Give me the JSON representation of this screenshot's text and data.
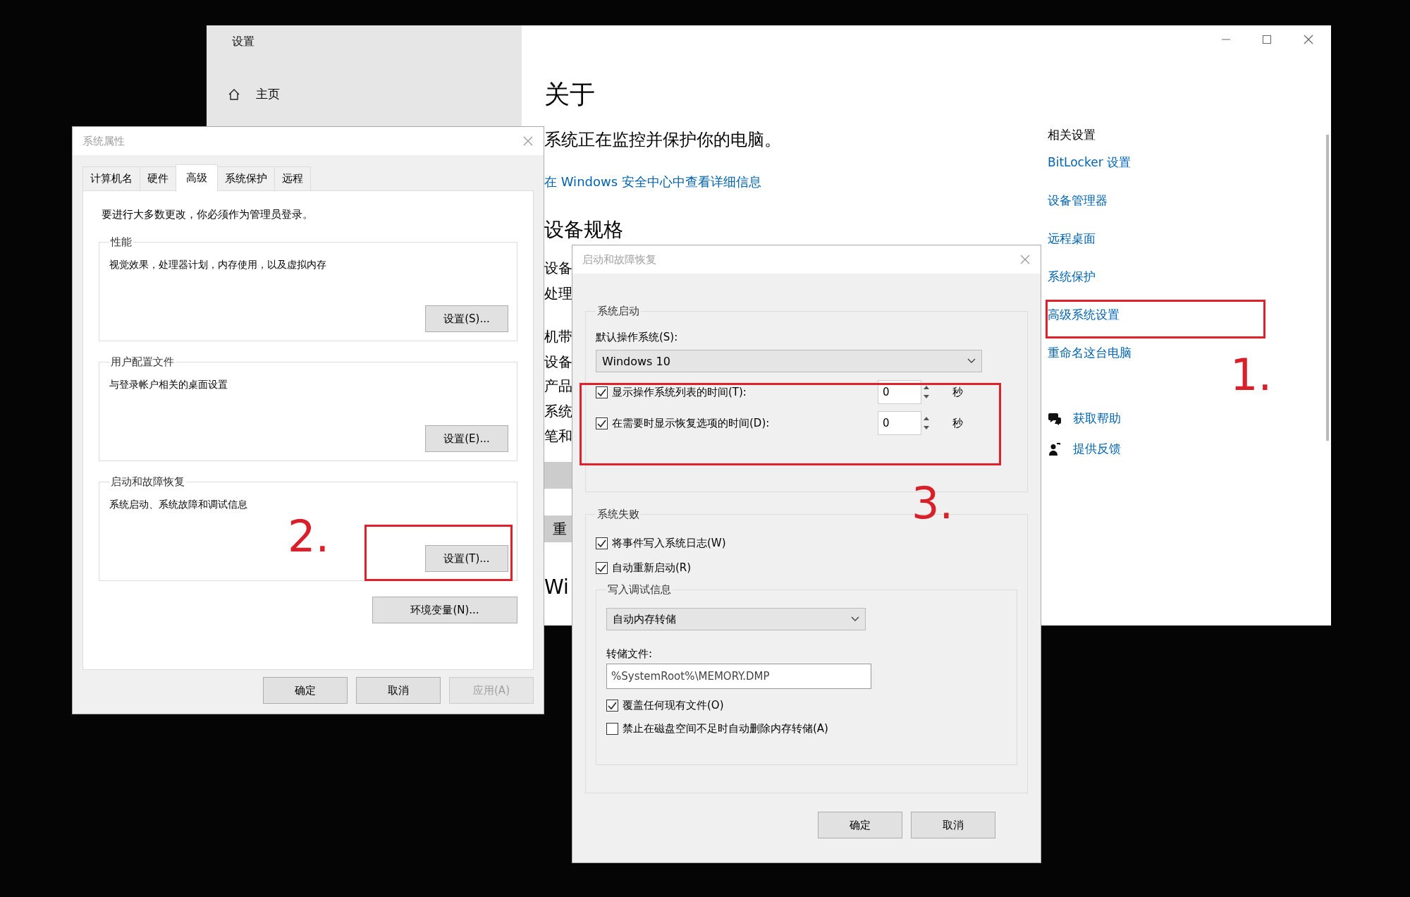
{
  "settings_window": {
    "title": "设置",
    "nav": [
      {
        "label": "主页",
        "kind": "home"
      }
    ],
    "heading": "关于",
    "status_text": "系统正在监控并保护你的电脑。",
    "security_link": "在 Windows 安全中心中查看详细信息",
    "specs_heading": "设备规格",
    "spec_labels": [
      "设备",
      "处理",
      "机带",
      "设备",
      "产品",
      "系统",
      "笔和"
    ],
    "rename_button": "重",
    "windows_heading": "Wi",
    "related_heading": "相关设置",
    "related_links": [
      "BitLocker 设置",
      "设备管理器",
      "远程桌面",
      "系统保护",
      "高级系统设置",
      "重命名这台电脑"
    ],
    "help_links": [
      {
        "label": "获取帮助",
        "kind": "help"
      },
      {
        "label": "提供反馈",
        "kind": "feedback"
      }
    ]
  },
  "system_properties": {
    "title": "系统属性",
    "tabs": [
      {
        "label": "计算机名",
        "selected": false
      },
      {
        "label": "硬件",
        "selected": false
      },
      {
        "label": "高级",
        "selected": true
      },
      {
        "label": "系统保护",
        "selected": false
      },
      {
        "label": "远程",
        "selected": false
      }
    ],
    "notice": "要进行大多数更改，你必须作为管理员登录。",
    "groups": [
      {
        "title": "性能",
        "description": "视觉效果，处理器计划，内存使用，以及虚拟内存",
        "button": "设置(S)..."
      },
      {
        "title": "用户配置文件",
        "description": "与登录帐户相关的桌面设置",
        "button": "设置(E)..."
      },
      {
        "title": "启动和故障恢复",
        "description": "系统启动、系统故障和调试信息",
        "button": "设置(T)..."
      }
    ],
    "env_button": "环境变量(N)...",
    "buttons": [
      {
        "label": "确定",
        "disabled": false
      },
      {
        "label": "取消",
        "disabled": false
      },
      {
        "label": "应用(A)",
        "disabled": true
      }
    ]
  },
  "startup_recovery": {
    "title": "启动和故障恢复",
    "startup_group": "系统启动",
    "default_os_label": "默认操作系统(S):",
    "default_os": "Windows 10",
    "timers": [
      {
        "label": "显示操作系统列表的时间(T):",
        "checked": true,
        "value": "0",
        "unit": "秒"
      },
      {
        "label": "在需要时显示恢复选项的时间(D):",
        "checked": true,
        "value": "0",
        "unit": "秒"
      }
    ],
    "failure_group": "系统失败",
    "failure_options": [
      {
        "label": "将事件写入系统日志(W)",
        "checked": true
      },
      {
        "label": "自动重新启动(R)",
        "checked": true
      }
    ],
    "debug_group": "写入调试信息",
    "debug_type": "自动内存转储",
    "dump_file_label": "转储文件:",
    "dump_file": "%SystemRoot%\\MEMORY.DMP",
    "dump_options": [
      {
        "label": "覆盖任何现有文件(O)",
        "checked": true
      },
      {
        "label": "禁止在磁盘空间不足时自动删除内存转储(A)",
        "checked": false
      }
    ],
    "buttons": [
      {
        "label": "确定"
      },
      {
        "label": "取消"
      }
    ]
  },
  "annotations": [
    {
      "label": "1."
    },
    {
      "label": "2."
    },
    {
      "label": "3."
    }
  ]
}
